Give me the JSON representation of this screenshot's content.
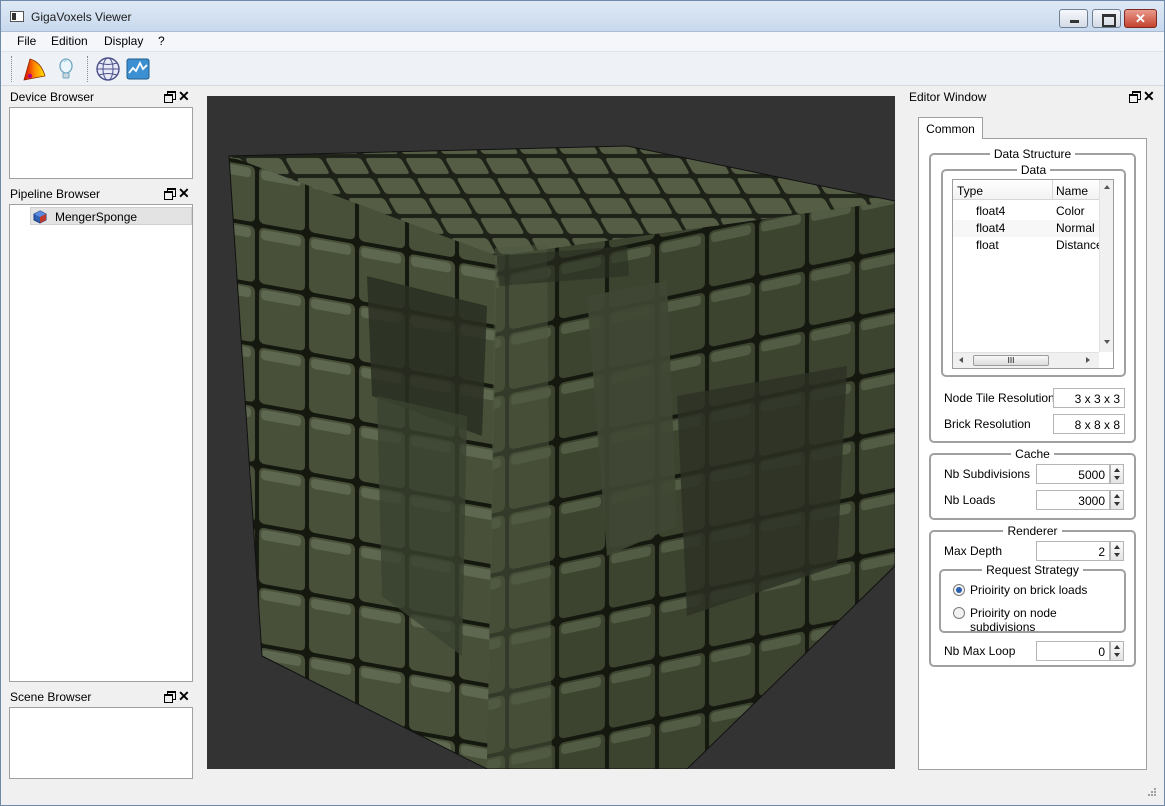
{
  "window": {
    "title": "GigaVoxels Viewer",
    "close_glyph": "✕"
  },
  "menu": [
    "File",
    "Edition",
    "Display",
    "?"
  ],
  "toolbar": {
    "icons": [
      "transfer-function-icon",
      "light-bulb-icon",
      "globe-icon",
      "performance-graph-icon"
    ]
  },
  "docks": {
    "device_browser": {
      "title": "Device Browser"
    },
    "pipeline_browser": {
      "title": "Pipeline Browser",
      "items": [
        "MengerSponge"
      ]
    },
    "scene_browser": {
      "title": "Scene Browser"
    },
    "close_glyph": "✕"
  },
  "editor": {
    "title": "Editor Window",
    "tab": "Common",
    "data_structure": {
      "title": "Data Structure",
      "data": {
        "title": "Data",
        "columns": [
          "Type",
          "Name"
        ],
        "rows": [
          {
            "type": "float4",
            "name": "Color"
          },
          {
            "type": "float4",
            "name": "Normal"
          },
          {
            "type": "float",
            "name": "Distance"
          }
        ],
        "scroll_grip": "III"
      },
      "node_tile_resolution": {
        "label": "Node Tile Resolution",
        "value": "3 x 3 x 3"
      },
      "brick_resolution": {
        "label": "Brick Resolution",
        "value": "8 x 8 x 8"
      }
    },
    "cache": {
      "title": "Cache",
      "nb_subdivisions": {
        "label": "Nb Subdivisions",
        "value": "5000"
      },
      "nb_loads": {
        "label": "Nb Loads",
        "value": "3000"
      }
    },
    "renderer": {
      "title": "Renderer",
      "max_depth": {
        "label": "Max Depth",
        "value": "2"
      },
      "request_strategy": {
        "title": "Request Strategy",
        "options": [
          {
            "label": "Prioirity on brick loads",
            "selected": true
          },
          {
            "label": "Prioirity on node subdivisions",
            "selected": false
          }
        ]
      },
      "nb_max_loop": {
        "label": "Nb Max Loop",
        "value": "0"
      }
    }
  },
  "colors": {
    "viewport_bg": "#333333",
    "cube_face": "#4d5540",
    "cube_edge": "#151812",
    "selection": "#e3e3e3"
  }
}
